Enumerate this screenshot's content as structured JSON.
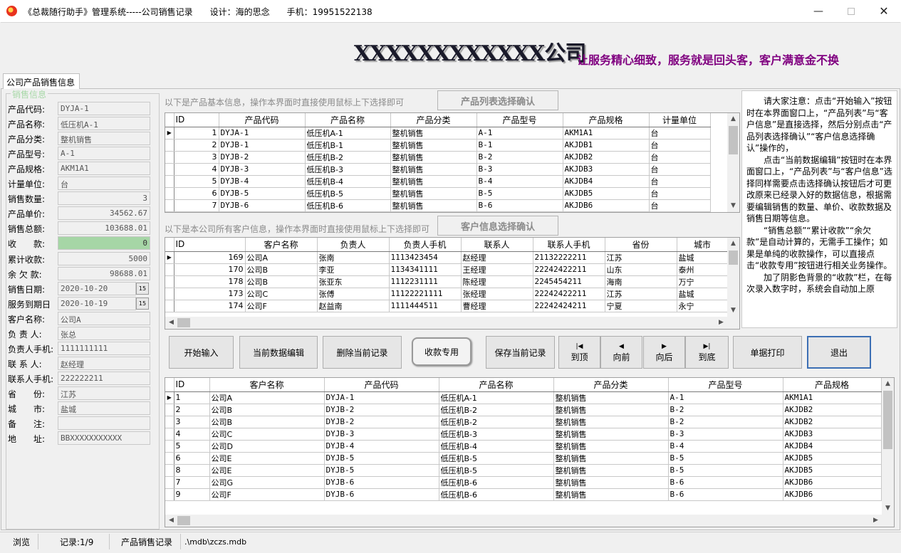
{
  "window": {
    "title": "《总裁随行助手》管理系统-----公司销售记录　　设计：海的思念　　手机：19951522138"
  },
  "banner": {
    "company": "XXXXXXXXXXXX公司",
    "slogan": "让服务精心细致，服务就是回头客，客户满意金不换"
  },
  "tab_label": "公司产品销售信息",
  "group_legend": "销售信息",
  "form": [
    {
      "label": "产品代码:",
      "value": "DYJA-1"
    },
    {
      "label": "产品名称:",
      "value": "低压机A-1"
    },
    {
      "label": "产品分类:",
      "value": "整机销售"
    },
    {
      "label": "产品型号:",
      "value": "A-1"
    },
    {
      "label": "产品规格:",
      "value": "AKM1A1"
    },
    {
      "label": "计量单位:",
      "value": "台"
    },
    {
      "label": "销售数量:",
      "value": "3"
    },
    {
      "label": "产品单价:",
      "value": "34562.67"
    },
    {
      "label": "销售总额:",
      "value": "103688.01"
    },
    {
      "label": "收　　款:",
      "value": "0"
    },
    {
      "label": "累计收款:",
      "value": "5000"
    },
    {
      "label": "余 欠 款:",
      "value": "98688.01"
    },
    {
      "label": "销售日期:",
      "value": "2020-10-20"
    },
    {
      "label": "服务到期日",
      "value": "2020-10-19"
    },
    {
      "label": "客户名称:",
      "value": "公司A"
    },
    {
      "label": "负 责 人:",
      "value": "张总"
    },
    {
      "label": "负责人手机:",
      "value": "1111111111"
    },
    {
      "label": "联 系 人:",
      "value": "赵经理"
    },
    {
      "label": "联系人手机:",
      "value": "222222211"
    },
    {
      "label": "省　　份:",
      "value": "江苏"
    },
    {
      "label": "城　　市:",
      "value": "盐城"
    },
    {
      "label": "备　　注:",
      "value": ""
    },
    {
      "label": "地　　址:",
      "value": "BBXXXXXXXXXXX"
    }
  ],
  "product_section": {
    "hint": "以下是产品基本信息，操作本界面时直接使用鼠标上下选择即可",
    "confirm_button": "产品列表选择确认",
    "headers": [
      "ID",
      "产品代码",
      "产品名称",
      "产品分类",
      "产品型号",
      "产品规格",
      "计量单位"
    ],
    "rows": [
      [
        "1",
        "DYJA-1",
        "低压机A-1",
        "整机销售",
        "A-1",
        "AKM1A1",
        "台"
      ],
      [
        "2",
        "DYJB-1",
        "低压机B-1",
        "整机销售",
        "B-1",
        "AKJDB1",
        "台"
      ],
      [
        "3",
        "DYJB-2",
        "低压机B-2",
        "整机销售",
        "B-2",
        "AKJDB2",
        "台"
      ],
      [
        "4",
        "DYJB-3",
        "低压机B-3",
        "整机销售",
        "B-3",
        "AKJDB3",
        "台"
      ],
      [
        "5",
        "DYJB-4",
        "低压机B-4",
        "整机销售",
        "B-4",
        "AKJDB4",
        "台"
      ],
      [
        "6",
        "DYJB-5",
        "低压机B-5",
        "整机销售",
        "B-5",
        "AKJDB5",
        "台"
      ],
      [
        "7",
        "DYJB-6",
        "低压机B-6",
        "整机销售",
        "B-6",
        "AKJDB6",
        "台"
      ]
    ]
  },
  "customer_section": {
    "hint": "以下是本公司所有客户信息，操作本界面时直接使用鼠标上下选择即可",
    "confirm_button": "客户信息选择确认",
    "headers": [
      "ID",
      "客户名称",
      "负责人",
      "负责人手机",
      "联系人",
      "联系人手机",
      "省份",
      "城市"
    ],
    "rows": [
      [
        "169",
        "公司A",
        "张南",
        "1113423454",
        "赵经理",
        "21132222211",
        "江苏",
        "盐城"
      ],
      [
        "170",
        "公司B",
        "李亚",
        "1134341111",
        "王经理",
        "22242422211",
        "山东",
        "泰州"
      ],
      [
        "178",
        "公司B",
        "张亚东",
        "1112231111",
        "陈经理",
        "2245454211",
        "海南",
        "万宁"
      ],
      [
        "173",
        "公司C",
        "张傅",
        "11122221111",
        "张经理",
        "22242422211",
        "江苏",
        "盐城"
      ],
      [
        "174",
        "公司F",
        "赵益南",
        "1111444511",
        "曹经理",
        "22242424211",
        "宁夏",
        "永宁"
      ]
    ]
  },
  "notes": [
    "请大家注意：点击“开始输入”按钮时在本界面窗口上，“产品列表”与“客户信息”是直接选择，然后分别点击“产品列表选择确认”“客户信息选择确认”操作的，",
    "点击“当前数据编辑”按钮时在本界面窗口上，“产品列表”与“客户信息”选择同样需要点击选择确认按钮后才可更改原来已经录入好的数据信息，根据需要编辑销售的数量、单价、收款数据及销售日期等信息。",
    "“销售总额”“累计收款”“余欠款”是自动计算的，无需手工操作；如果是单纯的收款操作，可以直接点击“收款专用”按钮进行相关业务操作。",
    "加了阴影色背景的“收款”栏，在每次录入数字时，系统会自动加上原"
  ],
  "buttons": {
    "start": "开始输入",
    "edit": "当前数据编辑",
    "delete": "删除当前记录",
    "payment": "收款专用",
    "save": "保存当前记录",
    "first": "到顶",
    "prev": "向前",
    "next": "向后",
    "last": "到底",
    "print": "单据打印",
    "exit": "退出"
  },
  "icons": {
    "first": "first-record-icon",
    "prev": "prev-record-icon",
    "next": "next-record-icon",
    "last": "last-record-icon"
  },
  "sales_section": {
    "headers": [
      "ID",
      "客户名称",
      "产品代码",
      "产品名称",
      "产品分类",
      "产品型号",
      "产品规格"
    ],
    "rows": [
      [
        "1",
        "公司A",
        "DYJA-1",
        "低压机A-1",
        "整机销售",
        "A-1",
        "AKM1A1"
      ],
      [
        "2",
        "公司B",
        "DYJB-2",
        "低压机B-2",
        "整机销售",
        "B-2",
        "AKJDB2"
      ],
      [
        "3",
        "公司B",
        "DYJB-2",
        "低压机B-2",
        "整机销售",
        "B-2",
        "AKJDB2"
      ],
      [
        "4",
        "公司C",
        "DYJB-3",
        "低压机B-3",
        "整机销售",
        "B-3",
        "AKJDB3"
      ],
      [
        "5",
        "公司D",
        "DYJB-4",
        "低压机B-4",
        "整机销售",
        "B-4",
        "AKJDB4"
      ],
      [
        "6",
        "公司E",
        "DYJB-5",
        "低压机B-5",
        "整机销售",
        "B-5",
        "AKJDB5"
      ],
      [
        "8",
        "公司E",
        "DYJB-5",
        "低压机B-5",
        "整机销售",
        "B-5",
        "AKJDB5"
      ],
      [
        "7",
        "公司G",
        "DYJB-6",
        "低压机B-6",
        "整机销售",
        "B-6",
        "AKJDB6"
      ],
      [
        "9",
        "公司F",
        "DYJB-6",
        "低压机B-6",
        "整机销售",
        "B-6",
        "AKJDB6"
      ]
    ]
  },
  "status": {
    "mode": "浏览",
    "record": "记录:1/9",
    "form": "产品销售记录",
    "db_path": ".\\mdb\\zczs.mdb"
  },
  "colors": {
    "slogan": "#800080",
    "payment_field": "#a6d6a6",
    "exit_border": "#3c6fb4"
  }
}
